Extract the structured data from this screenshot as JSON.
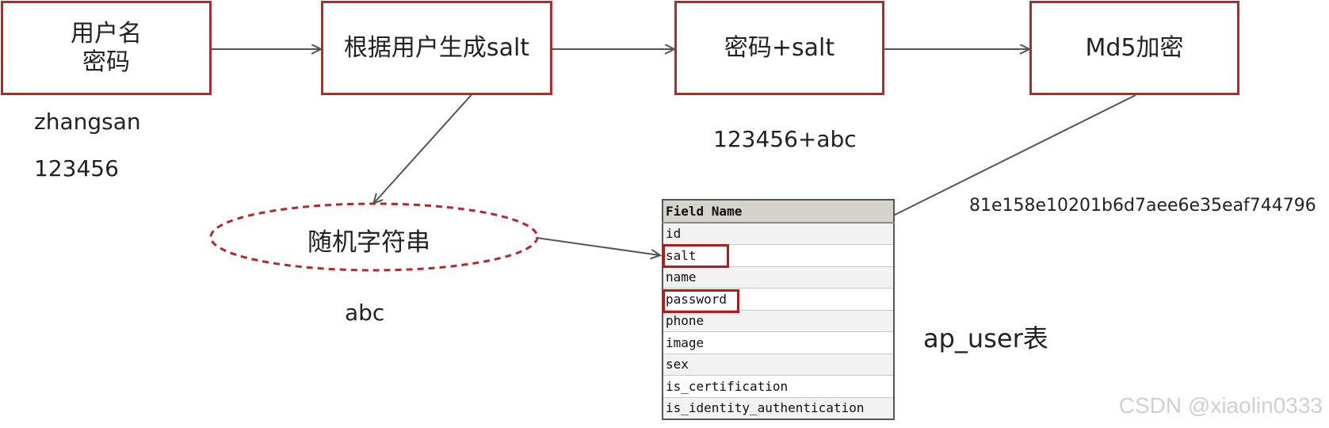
{
  "flow": {
    "box1": "用户名\n密码",
    "box2": "根据用户生成salt",
    "box3": "密码+salt",
    "box4": "Md5加密"
  },
  "labels": {
    "username_value": "zhangsan",
    "password_value": "123456",
    "combined_value": "123456+abc",
    "hash_value": "81e158e10201b6d7aee6e35eaf744796",
    "random_value": "abc",
    "table_caption": "ap_user表"
  },
  "random_node": {
    "label": "随机字符串"
  },
  "table": {
    "header": "Field Name",
    "rows": [
      "id",
      "salt",
      "name",
      "password",
      "phone",
      "image",
      "sex",
      "is_certification",
      "is_identity_authentication"
    ]
  },
  "watermark": "CSDN @xiaolin0333",
  "colors": {
    "accent": "#b02a2e",
    "arrow": "#555555"
  }
}
